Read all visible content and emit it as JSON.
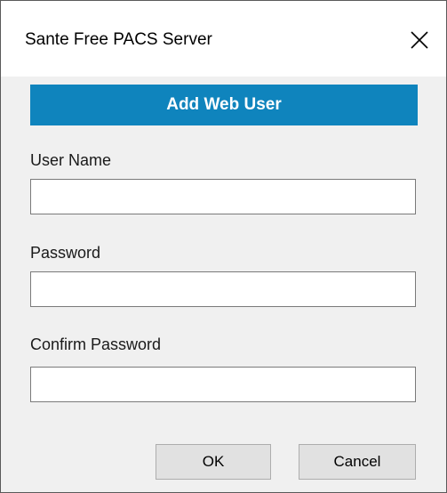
{
  "window": {
    "title": "Sante Free PACS Server",
    "close_icon": "close-icon"
  },
  "banner": {
    "title": "Add Web User",
    "color": "#0f84bd"
  },
  "form": {
    "user_name_label": "User Name",
    "user_name_value": "",
    "password_label": "Password",
    "password_value": "",
    "confirm_password_label": "Confirm Password",
    "confirm_password_value": ""
  },
  "buttons": {
    "ok_label": "OK",
    "cancel_label": "Cancel"
  }
}
